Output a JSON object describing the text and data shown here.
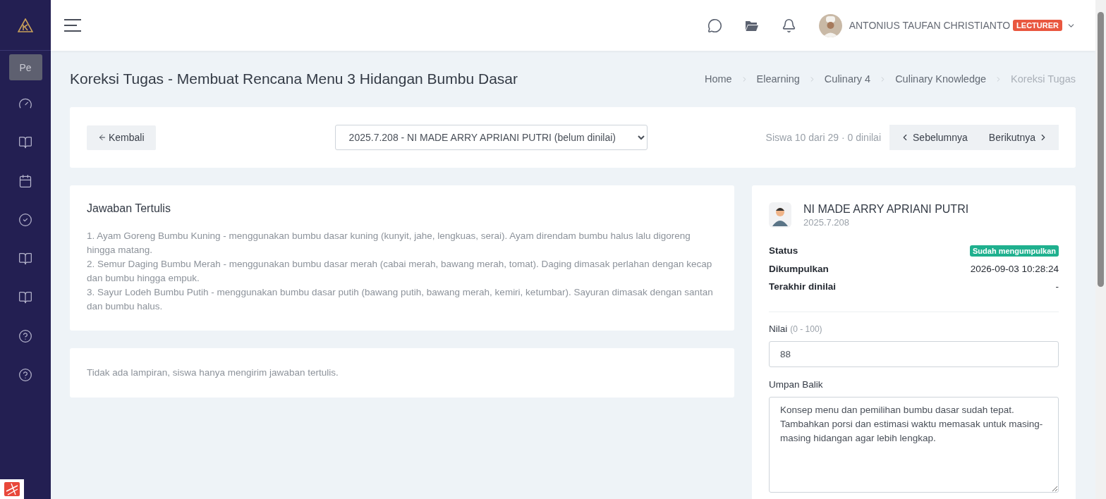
{
  "sidebar": {
    "badge": "Pe",
    "items": [
      {
        "kind": "gauge"
      },
      {
        "kind": "book"
      },
      {
        "kind": "calendar"
      },
      {
        "kind": "check"
      },
      {
        "kind": "book"
      },
      {
        "kind": "book"
      },
      {
        "kind": "help"
      },
      {
        "kind": "help"
      }
    ]
  },
  "topbar": {
    "user_name": "ANTONIUS TAUFAN CHRISTIANTO",
    "role": "LECTURER"
  },
  "page": {
    "title": "Koreksi Tugas - Membuat Rencana Menu 3 Hidangan Bumbu Dasar",
    "breadcrumbs": [
      {
        "label": "Home",
        "current": false
      },
      {
        "label": "Elearning",
        "current": false
      },
      {
        "label": "Culinary 4",
        "current": false
      },
      {
        "label": "Culinary Knowledge",
        "current": false
      },
      {
        "label": "Koreksi Tugas",
        "current": true
      }
    ]
  },
  "toolbar": {
    "back": "Kembali",
    "student_select": "2025.7.208 - NI MADE ARRY APRIANI PUTRI (belum dinilai)",
    "progress": "Siswa 10 dari 29 · 0 dinilai",
    "prev": "Sebelumnya",
    "next": "Berikutnya"
  },
  "answer": {
    "title": "Jawaban Tertulis",
    "lines": [
      "1. Ayam Goreng Bumbu Kuning - menggunakan bumbu dasar kuning (kunyit, jahe, lengkuas, serai). Ayam direndam bumbu halus lalu digoreng hingga matang.",
      "2. Semur Daging Bumbu Merah - menggunakan bumbu dasar merah (cabai merah, bawang merah, tomat). Daging dimasak perlahan dengan kecap dan bumbu hingga empuk.",
      "3. Sayur Lodeh Bumbu Putih - menggunakan bumbu dasar putih (bawang putih, bawang merah, kemiri, ketumbar). Sayuran dimasak dengan santan dan bumbu halus."
    ]
  },
  "attachments": {
    "note": "Tidak ada lampiran, siswa hanya mengirim jawaban tertulis."
  },
  "student": {
    "name": "NI MADE ARRY APRIANI PUTRI",
    "id": "2025.7.208",
    "details": [
      {
        "label": "Status",
        "value": "Sudah mengumpulkan",
        "kind": "badge"
      },
      {
        "label": "Dikumpulkan",
        "value": "2026-09-03 10:28:24",
        "kind": "text"
      },
      {
        "label": "Terakhir dinilai",
        "value": "-",
        "kind": "text"
      }
    ]
  },
  "grading": {
    "score_label": "Nilai",
    "score_range": "(0 - 100)",
    "score": "88",
    "feedback_label": "Umpan Balik",
    "feedback": "Konsep menu dan pemilihan bumbu dasar sudah tepat. Tambahkan porsi dan estimasi waktu memasak untuk masing-masing hidangan agar lebih lengkap."
  }
}
